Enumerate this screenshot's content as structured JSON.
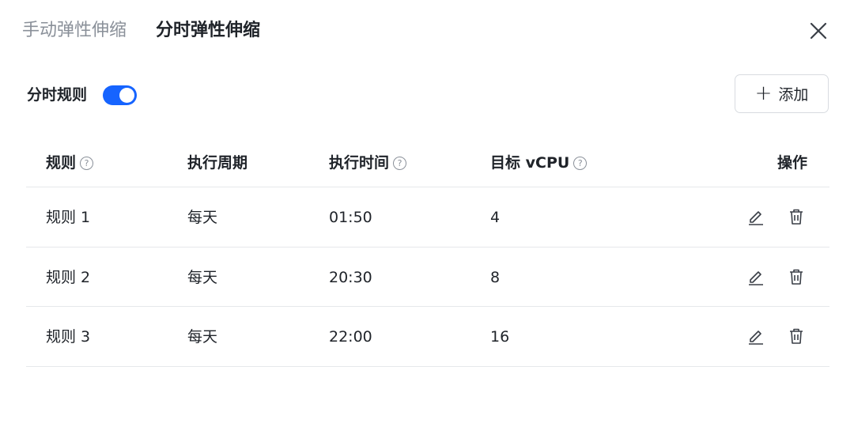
{
  "tabs": [
    {
      "label": "手动弹性伸缩",
      "active": false
    },
    {
      "label": "分时弹性伸缩",
      "active": true
    }
  ],
  "close_icon": "close-icon",
  "switch": {
    "label": "分时规则",
    "on": true,
    "color": "#1664ff"
  },
  "add_button": {
    "icon": "plus-icon",
    "label": "添加"
  },
  "table": {
    "columns": [
      {
        "label": "规则",
        "help": true
      },
      {
        "label": "执行周期",
        "help": false
      },
      {
        "label": "执行时间",
        "help": true
      },
      {
        "label": "目标 vCPU",
        "help": true
      },
      {
        "label": "操作",
        "help": false
      }
    ],
    "help_glyph": "?",
    "rows": [
      {
        "rule": "规则 1",
        "period": "每天",
        "time": "01:50",
        "vcpu": "4"
      },
      {
        "rule": "规则 2",
        "period": "每天",
        "time": "20:30",
        "vcpu": "8"
      },
      {
        "rule": "规则 3",
        "period": "每天",
        "time": "22:00",
        "vcpu": "16"
      }
    ],
    "row_actions": [
      "edit-icon",
      "delete-icon"
    ]
  }
}
